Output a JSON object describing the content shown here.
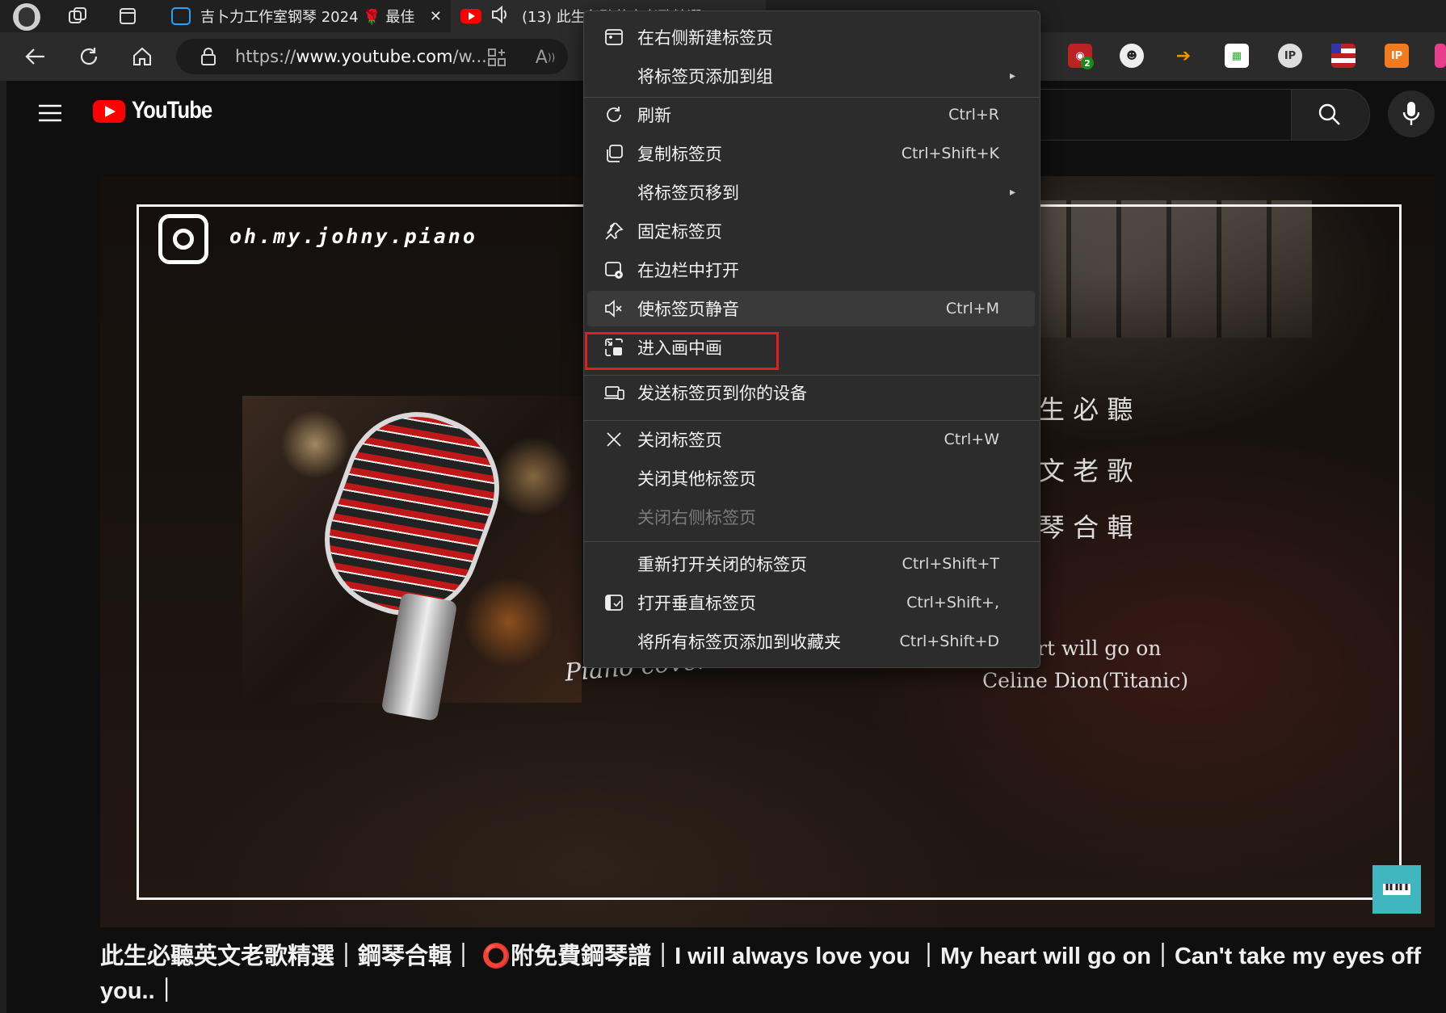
{
  "tabs": [
    {
      "title": "吉卜力工作室钢琴 2024 🌹 最佳",
      "close_glyph": "✕"
    },
    {
      "title": "(13) 此生必聽英文老歌精選"
    }
  ],
  "toolbar": {
    "url_prefix": "https://",
    "url_domain": "www.youtube.com",
    "url_rest": "/w...",
    "extension_badge": "2"
  },
  "youtube": {
    "logo_text": "YouTube"
  },
  "video": {
    "ig_handle": "oh.my.johny.piano",
    "piano_cover": "Piano cover",
    "right_lines": [
      "生 必 聽",
      "文 老 歌",
      "琴 合 輯"
    ],
    "song_line": "rt will go on",
    "artist_line": "Celine Dion(Titanic)",
    "title": "此生必聽英文老歌精選｜鋼琴合輯｜ ⭕附免費鋼琴譜｜I will always love you ｜My heart will go on｜Can't take my eyes off you..｜"
  },
  "context_menu": {
    "items": [
      {
        "label": "在右侧新建标签页",
        "shortcut": "",
        "icon": "new-tab-right-icon"
      },
      {
        "label": "将标签页添加到组",
        "shortcut": "",
        "submenu": true
      },
      {
        "label": "刷新",
        "shortcut": "Ctrl+R",
        "icon": "refresh-icon"
      },
      {
        "label": "复制标签页",
        "shortcut": "Ctrl+Shift+K",
        "icon": "duplicate-icon"
      },
      {
        "label": "将标签页移到",
        "shortcut": "",
        "submenu": true
      },
      {
        "label": "固定标签页",
        "shortcut": "",
        "icon": "pin-icon"
      },
      {
        "label": "在边栏中打开",
        "shortcut": "",
        "icon": "sidebar-icon"
      },
      {
        "label": "使标签页静音",
        "shortcut": "Ctrl+M",
        "icon": "mute-icon"
      },
      {
        "label": "进入画中画",
        "shortcut": "",
        "icon": "pip-icon"
      },
      {
        "label": "发送标签页到你的设备",
        "shortcut": "",
        "icon": "devices-icon"
      },
      {
        "label": "关闭标签页",
        "shortcut": "Ctrl+W",
        "icon": "close-icon"
      },
      {
        "label": "关闭其他标签页",
        "shortcut": ""
      },
      {
        "label": "关闭右侧标签页",
        "shortcut": "",
        "disabled": true
      },
      {
        "label": "重新打开关闭的标签页",
        "shortcut": "Ctrl+Shift+T"
      },
      {
        "label": "打开垂直标签页",
        "shortcut": "Ctrl+Shift+,",
        "icon": "vertical-tabs-icon"
      },
      {
        "label": "将所有标签页添加到收藏夹",
        "shortcut": "Ctrl+Shift+D"
      }
    ],
    "submenu_arrow": "▸"
  }
}
